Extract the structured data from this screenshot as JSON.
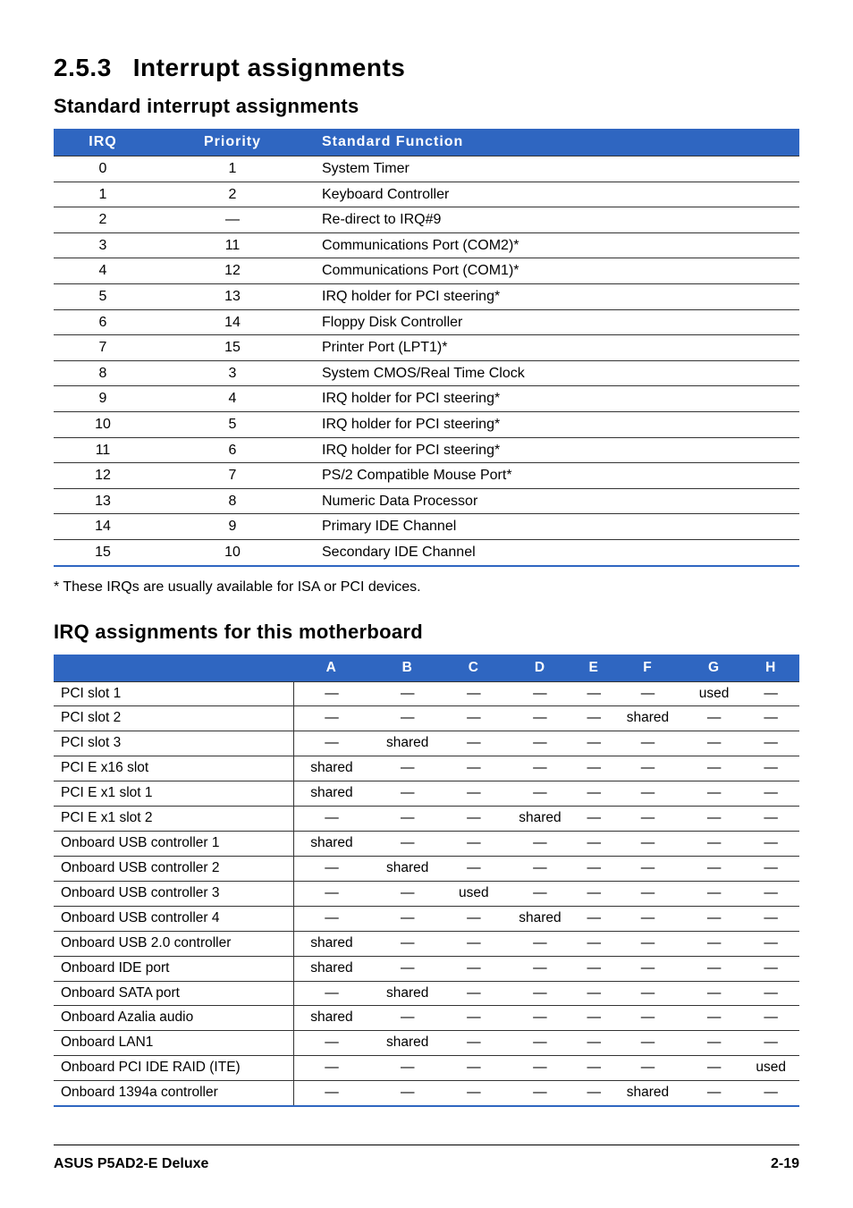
{
  "section": {
    "number": "2.5.3",
    "title": "Interrupt assignments"
  },
  "std_section_title": "Standard interrupt assignments",
  "std_table": {
    "headers": {
      "irq": "IRQ",
      "priority": "Priority",
      "func": "Standard Function"
    },
    "rows": [
      {
        "irq": "0",
        "priority": "1",
        "func": "System Timer"
      },
      {
        "irq": "1",
        "priority": "2",
        "func": "Keyboard Controller"
      },
      {
        "irq": "2",
        "priority": "—",
        "func": "Re-direct to IRQ#9"
      },
      {
        "irq": "3",
        "priority": "11",
        "func": "Communications Port (COM2)*"
      },
      {
        "irq": "4",
        "priority": "12",
        "func": "Communications Port (COM1)*"
      },
      {
        "irq": "5",
        "priority": "13",
        "func": "IRQ holder for PCI steering*"
      },
      {
        "irq": "6",
        "priority": "14",
        "func": "Floppy Disk Controller"
      },
      {
        "irq": "7",
        "priority": "15",
        "func": "Printer Port (LPT1)*"
      },
      {
        "irq": "8",
        "priority": "3",
        "func": "System CMOS/Real Time Clock"
      },
      {
        "irq": "9",
        "priority": "4",
        "func": "IRQ holder for PCI steering*"
      },
      {
        "irq": "10",
        "priority": "5",
        "func": "IRQ holder for PCI steering*"
      },
      {
        "irq": "11",
        "priority": "6",
        "func": "IRQ holder for PCI steering*"
      },
      {
        "irq": "12",
        "priority": "7",
        "func": "PS/2 Compatible Mouse Port*"
      },
      {
        "irq": "13",
        "priority": "8",
        "func": "Numeric Data Processor"
      },
      {
        "irq": "14",
        "priority": "9",
        "func": "Primary IDE Channel"
      },
      {
        "irq": "15",
        "priority": "10",
        "func": "Secondary IDE Channel"
      }
    ]
  },
  "footnote": "* These IRQs are usually available for ISA or PCI devices.",
  "mb_section_title": "IRQ assignments for this motherboard",
  "mb_table": {
    "cols": [
      "A",
      "B",
      "C",
      "D",
      "E",
      "F",
      "G",
      "H"
    ],
    "rows": [
      {
        "label": "PCI slot 1",
        "cells": [
          "—",
          "—",
          "—",
          "—",
          "—",
          "—",
          "used",
          "—"
        ]
      },
      {
        "label": "PCI slot 2",
        "cells": [
          "—",
          "—",
          "—",
          "—",
          "—",
          "shared",
          "—",
          "—"
        ]
      },
      {
        "label": "PCI slot 3",
        "cells": [
          "—",
          "shared",
          "—",
          "—",
          "—",
          "—",
          "—",
          "—"
        ]
      },
      {
        "label": "PCI E x16 slot",
        "cells": [
          "shared",
          "—",
          "—",
          "—",
          "—",
          "—",
          "—",
          "—"
        ]
      },
      {
        "label": "PCI E x1 slot 1",
        "cells": [
          "shared",
          "—",
          "—",
          "—",
          "—",
          "—",
          "—",
          "—"
        ]
      },
      {
        "label": "PCI E x1 slot 2",
        "cells": [
          "—",
          "—",
          "—",
          "shared",
          "—",
          "—",
          "—",
          "—"
        ]
      },
      {
        "label": "Onboard USB controller 1",
        "cells": [
          "shared",
          "—",
          "—",
          "—",
          "—",
          "—",
          "—",
          "—"
        ]
      },
      {
        "label": "Onboard USB controller 2",
        "cells": [
          "—",
          "shared",
          "—",
          "—",
          "—",
          "—",
          "—",
          "—"
        ]
      },
      {
        "label": "Onboard USB controller 3",
        "cells": [
          "—",
          "—",
          "used",
          "—",
          "—",
          "—",
          "—",
          "—"
        ]
      },
      {
        "label": "Onboard USB controller 4",
        "cells": [
          "—",
          "—",
          "—",
          "shared",
          "—",
          "—",
          "—",
          "—"
        ]
      },
      {
        "label": "Onboard USB 2.0 controller",
        "cells": [
          "shared",
          "—",
          "—",
          "—",
          "—",
          "—",
          "—",
          "—"
        ]
      },
      {
        "label": "Onboard IDE port",
        "cells": [
          "shared",
          "—",
          "—",
          "—",
          "—",
          "—",
          "—",
          "—"
        ]
      },
      {
        "label": "Onboard SATA port",
        "cells": [
          "—",
          "shared",
          "—",
          "—",
          "—",
          "—",
          "—",
          "—"
        ]
      },
      {
        "label": "Onboard Azalia audio",
        "cells": [
          "shared",
          "—",
          "—",
          "—",
          "—",
          "—",
          "—",
          "—"
        ]
      },
      {
        "label": "Onboard LAN1",
        "cells": [
          "—",
          "shared",
          "—",
          "—",
          "—",
          "—",
          "—",
          "—"
        ]
      },
      {
        "label": "Onboard PCI IDE RAID (ITE)",
        "cells": [
          "—",
          "—",
          "—",
          "—",
          "—",
          "—",
          "—",
          "used"
        ]
      },
      {
        "label": "Onboard 1394a controller",
        "cells": [
          "—",
          "—",
          "—",
          "—",
          "—",
          "shared",
          "—",
          "—"
        ]
      }
    ]
  },
  "footer": {
    "left": "ASUS P5AD2-E Deluxe",
    "right": "2-19"
  }
}
